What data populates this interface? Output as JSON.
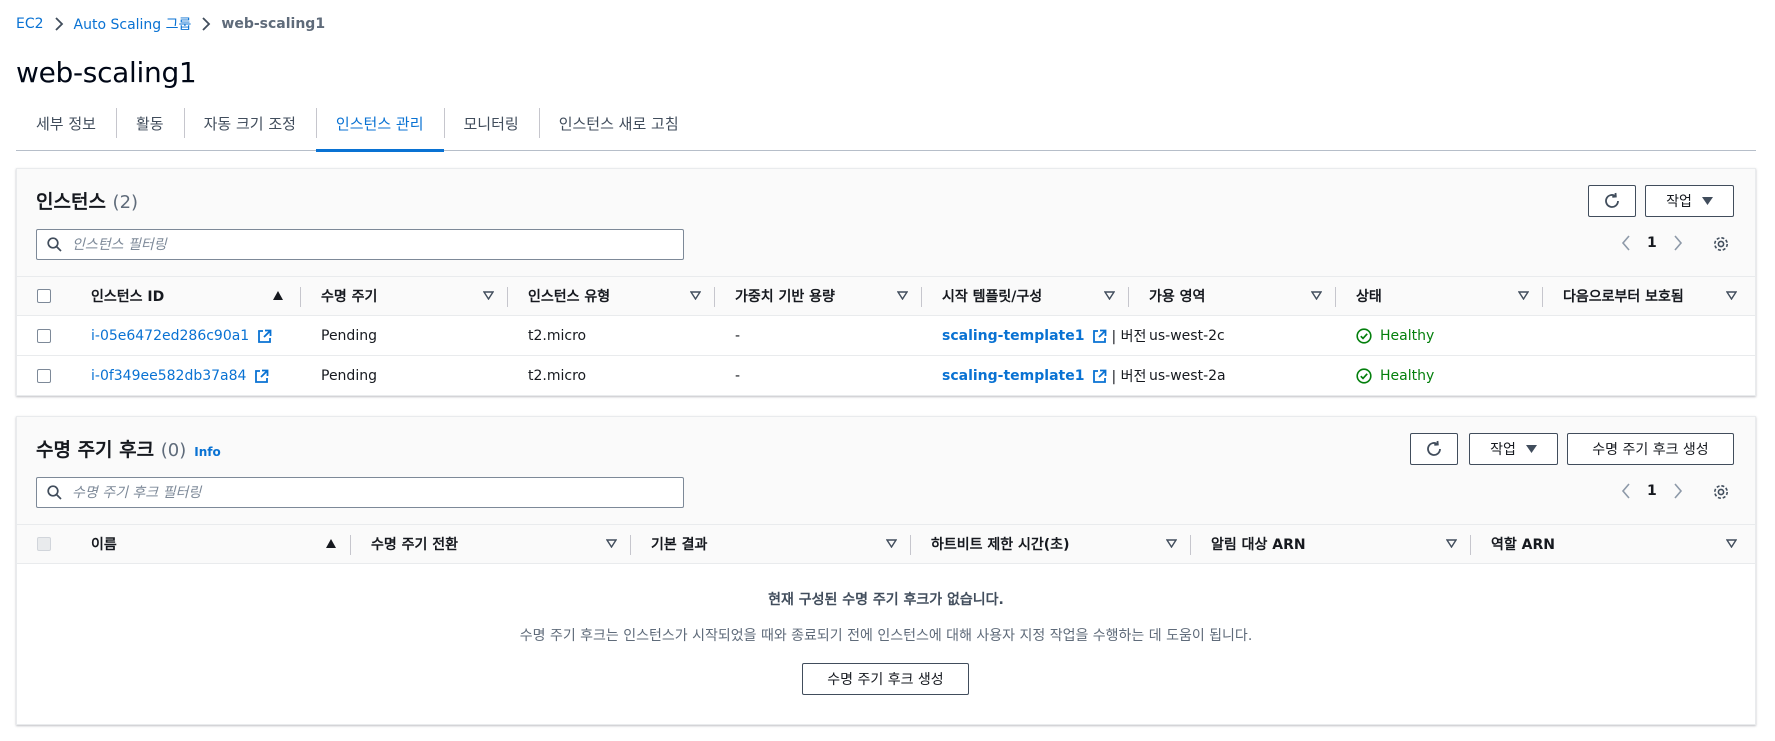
{
  "breadcrumb": {
    "items": [
      "EC2",
      "Auto Scaling 그룹"
    ],
    "current": "web-scaling1"
  },
  "page": {
    "title": "web-scaling1"
  },
  "tabs": [
    {
      "label": "세부 정보"
    },
    {
      "label": "활동"
    },
    {
      "label": "자동 크기 조정"
    },
    {
      "label": "인스턴스 관리",
      "active": true
    },
    {
      "label": "모니터링"
    },
    {
      "label": "인스턴스 새로 고침"
    }
  ],
  "instances": {
    "title": "인스턴스",
    "count": "(2)",
    "actions_label": "작업",
    "filter_placeholder": "인스턴스 필터링",
    "page": "1",
    "columns": [
      "인스턴스 ID",
      "수명 주기",
      "인스턴스 유형",
      "가중치 기반 용량",
      "시작 템플릿/구성",
      "가용 영역",
      "상태",
      "다음으로부터 보호됨"
    ],
    "rows": [
      {
        "id": "i-05e6472ed286c90a1",
        "lifecycle": "Pending",
        "type": "t2.micro",
        "weight": "-",
        "template": "scaling-template1",
        "version": "| 버전",
        "az": "us-west-2c",
        "status": "Healthy",
        "protected": ""
      },
      {
        "id": "i-0f349ee582db37a84",
        "lifecycle": "Pending",
        "type": "t2.micro",
        "weight": "-",
        "template": "scaling-template1",
        "version": "| 버전",
        "az": "us-west-2a",
        "status": "Healthy",
        "protected": ""
      }
    ]
  },
  "hooks": {
    "title": "수명 주기 후크",
    "count": "(0)",
    "info_label": "Info",
    "actions_label": "작업",
    "create_label": "수명 주기 후크 생성",
    "filter_placeholder": "수명 주기 후크 필터링",
    "page": "1",
    "columns": [
      "이름",
      "수명 주기 전환",
      "기본 결과",
      "하트비트 제한 시간(초)",
      "알림 대상 ARN",
      "역할 ARN"
    ],
    "empty_title": "현재 구성된 수명 주기 후크가 없습니다.",
    "empty_desc": "수명 주기 후크는 인스턴스가 시작되었을 때와 종료되기 전에 인스턴스에 대해 사용자 지정 작업을 수행하는 데 도움이 됩니다.",
    "empty_button": "수명 주기 후크 생성"
  },
  "colors": {
    "link": "#0972d3",
    "healthy": "#037f0c",
    "text": "#16191f",
    "muted": "#5f6b7a"
  }
}
